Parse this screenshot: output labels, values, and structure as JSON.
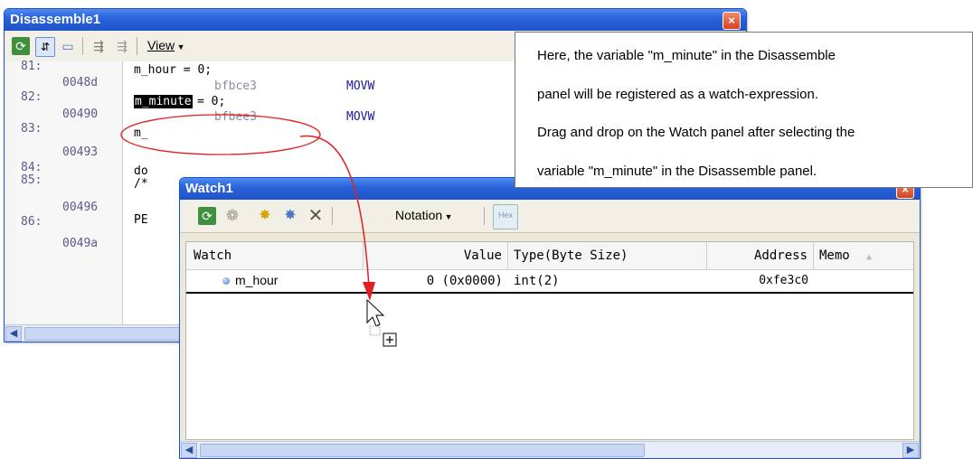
{
  "disassemble": {
    "title": "Disassemble1",
    "view_menu": "View",
    "lines": [
      {
        "line_no": "81:",
        "source": "m_hour = 0;"
      },
      {
        "addr": "0048d",
        "code": "bfbce3",
        "mnemonic": "MOVW"
      },
      {
        "line_no": "82:",
        "source_selected": "m_minute",
        "source_rest": " = 0;"
      },
      {
        "addr": "00490",
        "code": "bfbee3",
        "mnemonic": "MOVW"
      },
      {
        "line_no": "83:",
        "source": "m_"
      },
      {
        "addr": "00493"
      },
      {
        "line_no": "84:",
        "source": "do"
      },
      {
        "line_no": "85:",
        "source": "/*"
      },
      {
        "addr": "00496"
      },
      {
        "line_no": "86:",
        "source": "PE"
      },
      {
        "addr": "0049a"
      }
    ]
  },
  "watch": {
    "title": "Watch1",
    "notation_menu": "Notation",
    "hex_button": "Hex",
    "columns": [
      "Watch",
      "Value",
      "Type(Byte Size)",
      "Address",
      "Memo"
    ],
    "rows": [
      {
        "name": "m_hour",
        "value": "0 (0x0000)",
        "type": "int(2)",
        "address": "0xfe3c0",
        "memo": ""
      }
    ]
  },
  "callout": {
    "lines": [
      "Here, the variable \"m_minute\" in the Disassemble",
      "panel will be registered as a watch-expression.",
      "Drag and drop on the Watch panel after selecting the",
      "variable \"m_minute\" in the Disassemble panel."
    ]
  },
  "colors": {
    "title_bar": "#2a63db",
    "selection": "#000000",
    "drag_arrow": "#e02020"
  }
}
